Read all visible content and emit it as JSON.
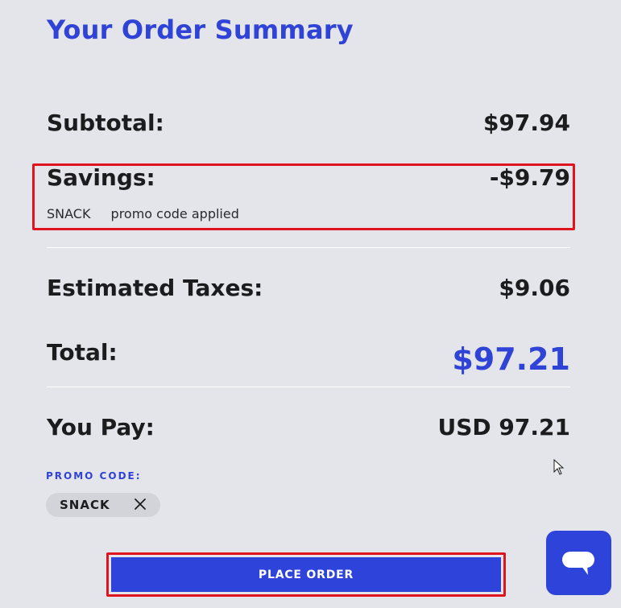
{
  "header": {
    "title": "Your Order Summary"
  },
  "summary": {
    "subtotal_label": "Subtotal:",
    "subtotal_value": "$97.94",
    "savings_label": "Savings:",
    "savings_value": "-$9.79",
    "savings_code": "SNACK",
    "savings_note": "promo code applied",
    "taxes_label": "Estimated Taxes:",
    "taxes_value": "$9.06",
    "total_label": "Total:",
    "total_value": "$97.21",
    "pay_label": "You Pay:",
    "pay_value": "USD 97.21"
  },
  "promo": {
    "label": "PROMO CODE:",
    "chip_code": "SNACK",
    "remove_icon": "close-icon"
  },
  "actions": {
    "place_order_label": "PLACE ORDER",
    "chat_icon": "chat-bubble-icon"
  },
  "colors": {
    "accent": "#2f43d6",
    "highlight": "#e0141e",
    "background": "#e4e5ea"
  }
}
